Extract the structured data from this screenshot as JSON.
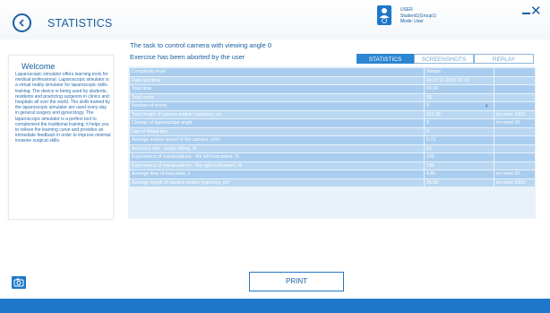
{
  "header": {
    "title": "STATISTICS",
    "user": {
      "label": "USER",
      "name": "Student1(Group1)",
      "mode": "Mode: User"
    }
  },
  "welcome": {
    "title": "Welcome",
    "text": "Laparoscopic simulator offers learning tools for medical professional. Laparoscopic simulator is a virtual reality simulator for laparoscopic skills training. The device is being used by students, residents and practicing surgeons in clinics and hospitals all over the world. The skills trained by the laparoscopic simulator are used every day in general surgery and gynecology. The laparoscopic simulator is a perfect tool to complement the traditional training; it helps you to relieve the learning curve and provides an immediate feedback in order to improve minimal invasive surgical skills."
  },
  "task": {
    "title": "The task to control camera with viewing angle 0",
    "status": "Exercise has been aborted by the user"
  },
  "tabs": [
    {
      "label": "STATISTICS",
      "active": true
    },
    {
      "label": "SCREENSHOTS",
      "active": false
    },
    {
      "label": "REPLAY",
      "active": false
    }
  ],
  "stats": [
    {
      "label": "Complexity level",
      "value": "Simple",
      "limit": ""
    },
    {
      "label": "Date and time",
      "value": "14.07.10.2016 02:15",
      "limit": ""
    },
    {
      "label": "Total time",
      "value": "00:24",
      "limit": ""
    },
    {
      "label": "Total score",
      "value": "50",
      "limit": ""
    },
    {
      "label": "Number of errors",
      "value": "0",
      "limit": ""
    },
    {
      "label": "Total length of camera motion trajectory, cm",
      "value": "122.96",
      "limit": "no more 1000"
    },
    {
      "label": "Change of laparoscope angle",
      "value": "0",
      "limit": "no more 15"
    },
    {
      "label": "Use of virtual tips",
      "value": "0",
      "limit": ""
    },
    {
      "label": "Average motion speed of the camera, cm/s",
      "value": "5.72",
      "limit": ""
    },
    {
      "label": "Accuracy rate - target hitting, %",
      "value": "50",
      "limit": ""
    },
    {
      "label": "Ergonomics of manipulations - the left instrument, %",
      "value": "100",
      "limit": ""
    },
    {
      "label": "Ergonomics of manipulations - the right instrument, %",
      "value": "100",
      "limit": ""
    },
    {
      "label": "Average time of execution, s",
      "value": "4.80",
      "limit": "no more 20"
    },
    {
      "label": "Average length of camera motion trajectory, cm",
      "value": "25.58",
      "limit": "no more 1000"
    }
  ],
  "actions": {
    "print_label": "PRINT"
  },
  "colors": {
    "accent": "#1f77c9",
    "row": "#a9cdef",
    "table_bg": "#e9f2fb"
  }
}
